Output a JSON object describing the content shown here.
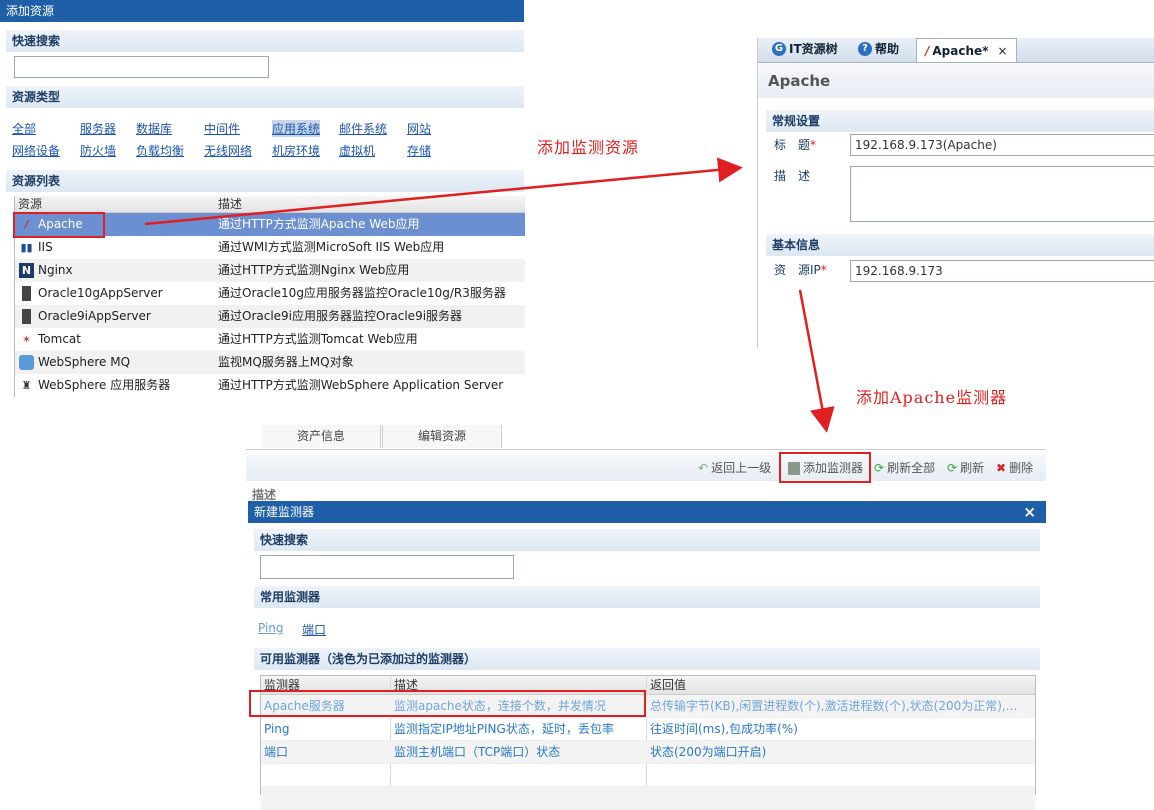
{
  "add_resource": {
    "title": "添加资源",
    "quick_search": "快速搜索",
    "resource_type_label": "资源类型",
    "types_row1": [
      "全部",
      "服务器",
      "数据库",
      "中间件",
      "应用系统",
      "邮件系统",
      "网站"
    ],
    "types_row2": [
      "网络设备",
      "防火墙",
      "负载均衡",
      "无线网络",
      "机房环境",
      "虚拟机",
      "存储"
    ],
    "resource_list_label": "资源列表",
    "col_resource": "资源",
    "col_desc": "描述",
    "rows": [
      {
        "name": "Apache",
        "desc": "通过HTTP方式监测Apache Web应用",
        "icon": "apache-icon"
      },
      {
        "name": "IIS",
        "desc": "通过WMI方式监测MicroSoft IIS Web应用",
        "icon": "iis-icon"
      },
      {
        "name": "Nginx",
        "desc": "通过HTTP方式监测Nginx Web应用",
        "icon": "nginx-icon"
      },
      {
        "name": "Oracle10gAppServer",
        "desc": "通过Oracle10g应用服务器监控Oracle10g/R3服务器",
        "icon": "oracle-icon"
      },
      {
        "name": "Oracle9iAppServer",
        "desc": "通过Oracle9i应用服务器监控Oracle9i服务器",
        "icon": "oracle-icon"
      },
      {
        "name": "Tomcat",
        "desc": "通过HTTP方式监测Tomcat Web应用",
        "icon": "tomcat-icon"
      },
      {
        "name": "WebSphere MQ",
        "desc": "监视MQ服务器上MQ对象",
        "icon": "websphere-mq-icon"
      },
      {
        "name": "WebSphere 应用服务器",
        "desc": "通过HTTP方式监测WebSphere Application Server",
        "icon": "websphere-icon"
      }
    ]
  },
  "annotations": {
    "add_resource": "添加监测资源",
    "add_monitor": "添加Apache监测器"
  },
  "apache_panel": {
    "tabs": [
      "IT资源树",
      "帮助",
      "Apache*"
    ],
    "tab_close": "×",
    "heading": "Apache",
    "general_settings": "常规设置",
    "title_label": "标　题",
    "title_value": "192.168.9.173(Apache)",
    "desc_label": "描　述",
    "basic_info": "基本信息",
    "ip_label": "资　源IP",
    "ip_value": "192.168.9.173",
    "required": "*"
  },
  "detail_tabs": [
    "资产信息",
    "编辑资源"
  ],
  "toolbar": {
    "back": "返回上一级",
    "add_monitor": "添加监测器",
    "refresh_all": "刷新全部",
    "refresh": "刷新",
    "delete": "删除"
  },
  "desc_partial": "描述",
  "new_monitor": {
    "title": "新建监测器",
    "close": "×",
    "quick_search": "快速搜索",
    "common_monitors": "常用监测器",
    "common_links": [
      "Ping",
      "端口"
    ],
    "available_label": "可用监测器（浅色为已添加过的监测器）",
    "col_monitor": "监测器",
    "col_desc": "描述",
    "col_return": "返回值",
    "rows": [
      {
        "name": "Apache服务器",
        "desc": "监测apache状态，连接个数，并发情况",
        "ret": "总传输字节(KB),闲置进程数(个),激活进程数(个),状态(200为正常),..."
      },
      {
        "name": "Ping",
        "desc": "监测指定IP地址PING状态，延时，丢包率",
        "ret": "往返时间(ms),包成功率(%)"
      },
      {
        "name": "端口",
        "desc": "监测主机端口（TCP端口）状态",
        "ret": "状态(200为端口开启)"
      }
    ]
  },
  "colors": {
    "accent": "#1f5fa8",
    "annotation": "#e02020",
    "selected_row": "#6b8fd0"
  }
}
